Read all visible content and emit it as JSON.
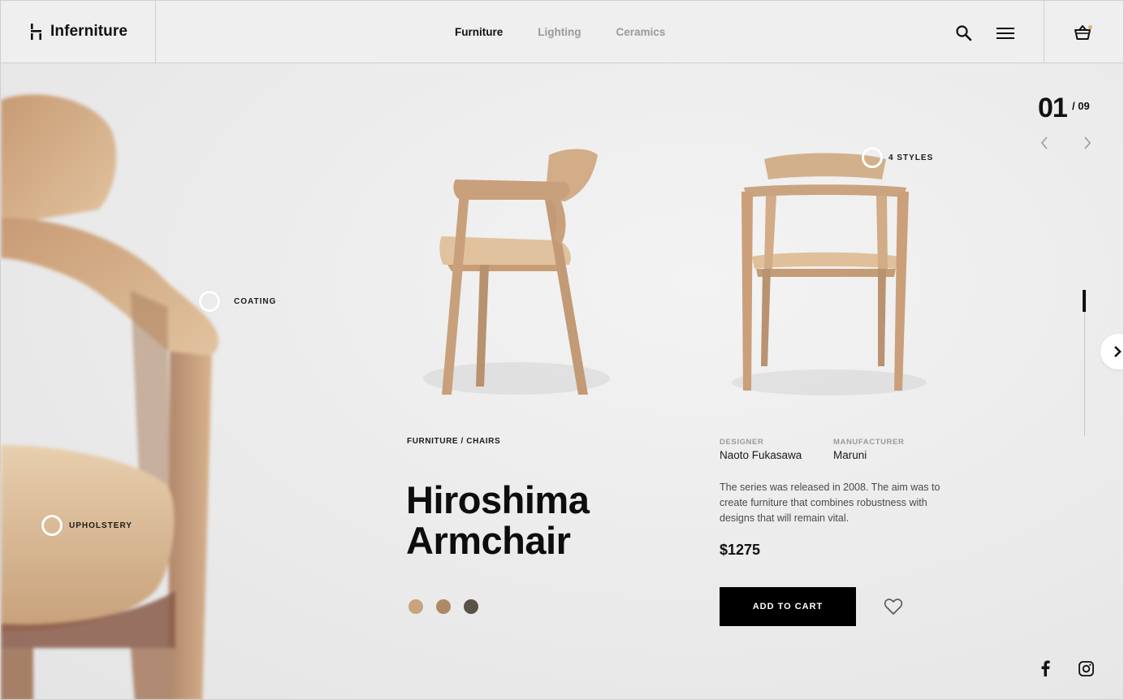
{
  "brand": {
    "name": "Inferniture",
    "logo_icon": "logo-mark-icon"
  },
  "nav": {
    "items": [
      {
        "label": "Furniture",
        "active": true
      },
      {
        "label": "Lighting",
        "active": false
      },
      {
        "label": "Ceramics",
        "active": false
      }
    ]
  },
  "header_icons": [
    "search-icon",
    "menu-icon",
    "cart-icon"
  ],
  "slider": {
    "current": "01",
    "total": "/ 09"
  },
  "hotspots": {
    "coating": "COATING",
    "upholstery": "UPHOLSTERY",
    "styles": "4 STYLES"
  },
  "product": {
    "breadcrumb": "FURNITURE / CHAIRS",
    "title_line1": "Hiroshima",
    "title_line2": "Armchair",
    "swatches": [
      "#c9a27e",
      "#ad8a66",
      "#5a5246"
    ],
    "designer_label": "DESIGNER",
    "designer": "Naoto Fukasawa",
    "manufacturer_label": "MANUFACTURER",
    "manufacturer": "Maruni",
    "description": "The series was released in 2008. The aim was to create furniture that combines robustness with designs that will remain vital.",
    "price": "$1275",
    "add_to_cart": "ADD TO CART"
  },
  "colors": {
    "accent": "#000000",
    "wood": "#d9b48f",
    "cart_dot": "#e0b27a"
  },
  "social": [
    "facebook-icon",
    "instagram-icon"
  ]
}
